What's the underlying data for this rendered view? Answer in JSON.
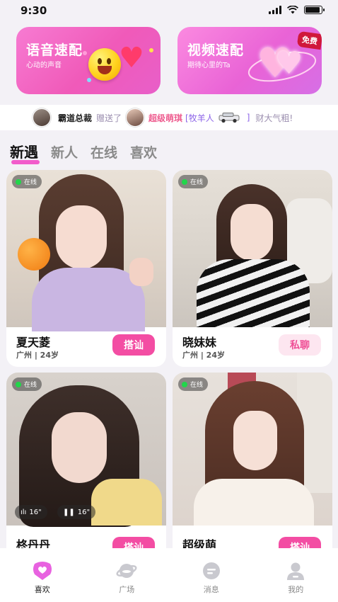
{
  "status_bar": {
    "time": "9:30"
  },
  "banners": [
    {
      "title": "语音速配",
      "subtitle": "心动的声音"
    },
    {
      "title": "视频速配",
      "subtitle": "期待心里的Ta",
      "badge": "免费"
    }
  ],
  "ticker": {
    "sender": "霸道总裁",
    "verb": "赠送了",
    "receiver": "超级萌琪",
    "gift": "[牧羊人",
    "gift_close": "]",
    "suffix": "财大气粗!"
  },
  "tabs": [
    "新遇",
    "新人",
    "在线",
    "喜欢"
  ],
  "online_label": "在线",
  "profiles": [
    {
      "name": "夏天菱",
      "meta": "广州 | 24岁",
      "action": "搭讪",
      "style": "pink"
    },
    {
      "name": "晓妹妹",
      "meta": "广州 | 24岁",
      "action": "私聊",
      "style": "light"
    },
    {
      "name": "柊丹丹",
      "meta": "",
      "action": "搭讪",
      "style": "pink",
      "voice": [
        "16\"",
        "16\""
      ]
    },
    {
      "name": "超级萌",
      "meta": "",
      "action": "搭讪",
      "style": "pink"
    }
  ],
  "bottom_nav": [
    {
      "label": "喜欢",
      "icon": "heart-chat-icon",
      "active": true
    },
    {
      "label": "广场",
      "icon": "planet-icon",
      "active": false
    },
    {
      "label": "消息",
      "icon": "message-icon",
      "active": false
    },
    {
      "label": "我的",
      "icon": "user-icon",
      "active": false
    }
  ],
  "colors": {
    "accent": "#f34da3",
    "online": "#21d64a",
    "background": "#f3f1f6"
  }
}
